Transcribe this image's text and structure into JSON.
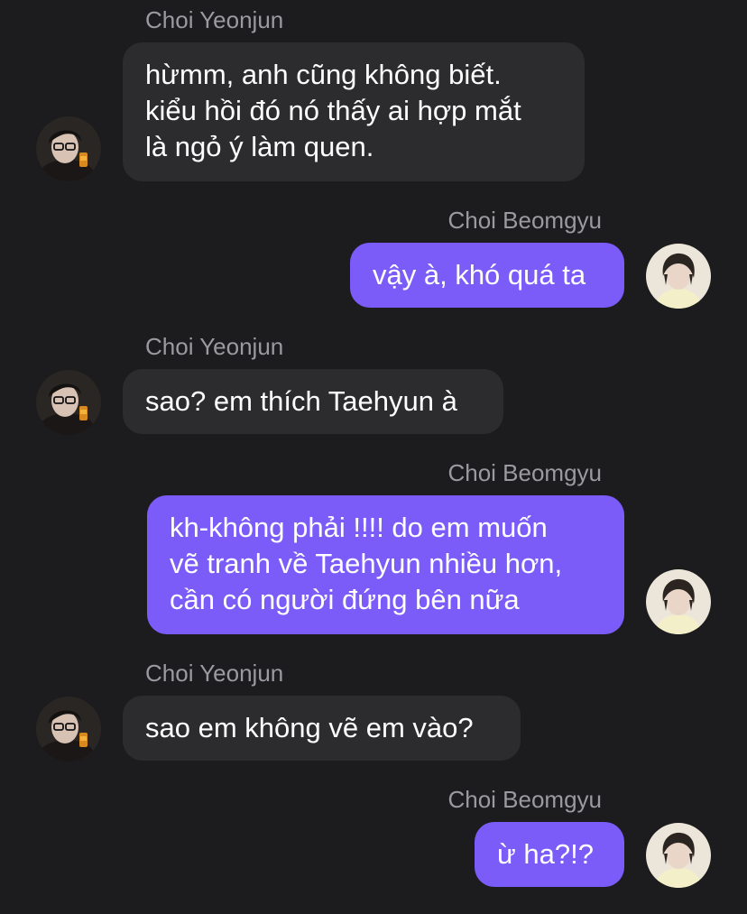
{
  "colors": {
    "background": "#1c1c1e",
    "incoming_bubble": "#2c2c2e",
    "outgoing_bubble": "#7c5cf9",
    "sender_name": "#9a9aa0",
    "message_text": "#ffffff"
  },
  "messages": [
    {
      "sender": "Choi Yeonjun",
      "direction": "incoming",
      "avatar_icon": "yeonjun-avatar-icon",
      "text": "hừmm, anh cũng không biết.\nkiểu hồi đó nó thấy ai hợp mắt\nlà ngỏ ý làm quen."
    },
    {
      "sender": "Choi Beomgyu",
      "direction": "outgoing",
      "avatar_icon": "beomgyu-avatar-icon",
      "text": "vậy à, khó quá ta"
    },
    {
      "sender": "Choi Yeonjun",
      "direction": "incoming",
      "avatar_icon": "yeonjun-avatar-icon",
      "text": "sao? em thích Taehyun à"
    },
    {
      "sender": "Choi Beomgyu",
      "direction": "outgoing",
      "avatar_icon": "beomgyu-avatar-icon",
      "text": "kh-không phải !!!! do em muốn\nvẽ tranh về Taehyun nhiều hơn,\ncần có người đứng bên nữa"
    },
    {
      "sender": "Choi Yeonjun",
      "direction": "incoming",
      "avatar_icon": "yeonjun-avatar-icon",
      "text": "sao em không vẽ em vào?"
    },
    {
      "sender": "Choi Beomgyu",
      "direction": "outgoing",
      "avatar_icon": "beomgyu-avatar-icon",
      "text": "ừ ha?!?"
    }
  ]
}
